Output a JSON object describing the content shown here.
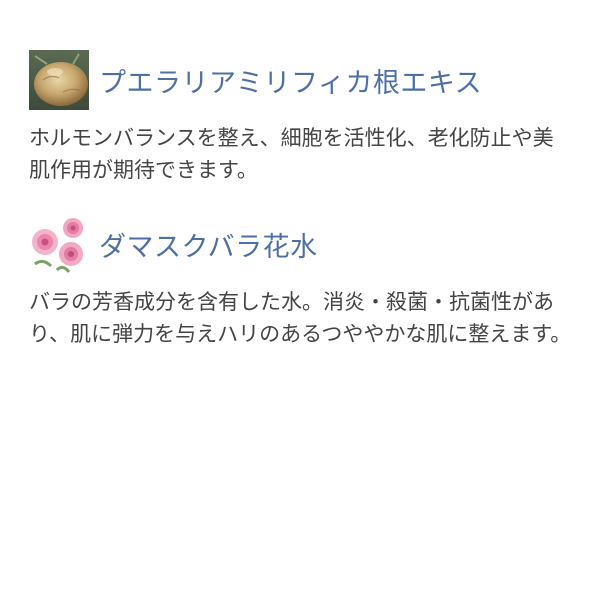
{
  "sections": [
    {
      "icon": "pueraria-root-icon",
      "heading": "プエラリアミリフィカ根エキス",
      "body": "ホルモンバランスを整え、細胞を活性化、老化防止や美肌作用が期待できます。"
    },
    {
      "icon": "rose-flower-icon",
      "heading": "ダマスクバラ花水",
      "body": "バラの芳香成分を含有した水。消炎・殺菌・抗菌性があり、肌に弾力を与えハリのあるつややかな肌に整えます。"
    }
  ],
  "colors": {
    "heading": "#4f6fa3",
    "body": "#444444",
    "background": "#ffffff"
  }
}
